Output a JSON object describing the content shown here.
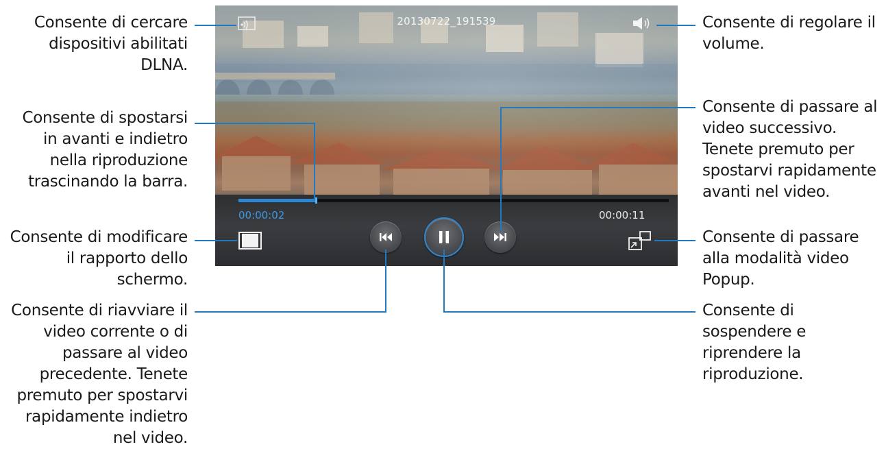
{
  "player": {
    "title": "20130722_191539",
    "current_time": "00:00:02",
    "total_time": "00:00:11",
    "progress_fraction": 0.18,
    "accent_color": "#2f86d1"
  },
  "icons": {
    "dlna": "dlna-icon",
    "volume": "speaker-icon",
    "ratio": "aspect-ratio-icon",
    "previous": "skip-previous-icon",
    "pause": "pause-icon",
    "next": "skip-next-icon",
    "popup": "popup-video-icon"
  },
  "callouts": {
    "dlna": "Consente di cercare\ndispositivi abilitati\nDLNA.",
    "seek": "Consente di spostarsi\nin avanti e indietro\nnella riproduzione\ntrascinando la barra.",
    "ratio": "Consente di modificare\nil rapporto dello\nschermo.",
    "previous": "Consente di riavviare il\nvideo corrente o di\npassare al video\nprecedente. Tenete\npremuto per spostarvi\nrapidamente indietro\nnel video.",
    "volume": "Consente di regolare il\nvolume.",
    "next": "Consente di passare al\nvideo successivo.\nTenete premuto per\nspostarvi rapidamente\navanti nel video.",
    "popup": "Consente di passare\nalla modalità video\nPopup.",
    "pause": "Consente di\nsospendere e\nriprendere la\nriproduzione."
  }
}
